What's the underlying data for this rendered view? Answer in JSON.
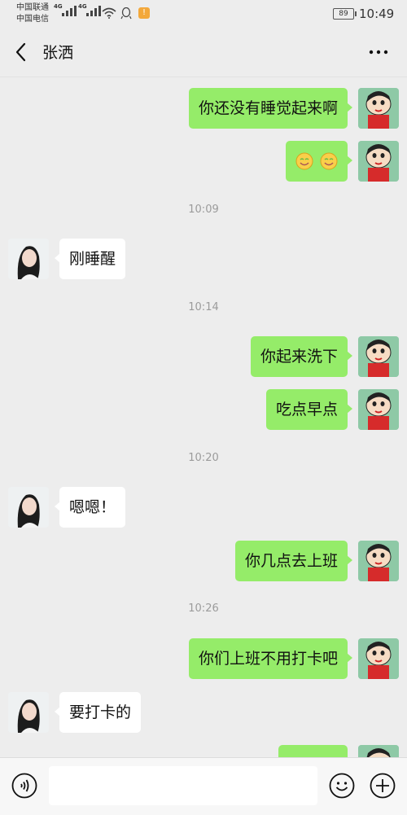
{
  "status_bar": {
    "carrier_1": "中国联通",
    "carrier_2": "中国电信",
    "net_1": "4G",
    "net_2": "4G",
    "battery": "89",
    "time": "10:49"
  },
  "header": {
    "title": "张洒"
  },
  "messages": [
    {
      "from": "me",
      "text": "你还没有睡觉起来啊"
    },
    {
      "from": "me",
      "text": "",
      "emoji": "smile-emoji x2"
    },
    {
      "time": "10:09"
    },
    {
      "from": "her",
      "text": "刚睡醒"
    },
    {
      "time": "10:14"
    },
    {
      "from": "me",
      "text": "你起来洗下"
    },
    {
      "from": "me",
      "text": "吃点早点"
    },
    {
      "time": "10:20"
    },
    {
      "from": "her",
      "text": "嗯嗯！"
    },
    {
      "from": "me",
      "text": "你几点去上班"
    },
    {
      "time": "10:26"
    },
    {
      "from": "me",
      "text": "你们上班不用打卡吧"
    },
    {
      "from": "her",
      "text": "要打卡的"
    }
  ],
  "input_bar": {
    "placeholder": ""
  },
  "colors": {
    "background": "#ededed",
    "my_bubble": "#95ec69",
    "her_bubble": "#ffffff",
    "timestamp": "#9b9b9b"
  },
  "icons": [
    "back-icon",
    "more-icon",
    "voice-icon",
    "emoji-icon",
    "plus-icon",
    "wifi-icon",
    "qq-icon",
    "battery-icon"
  ]
}
